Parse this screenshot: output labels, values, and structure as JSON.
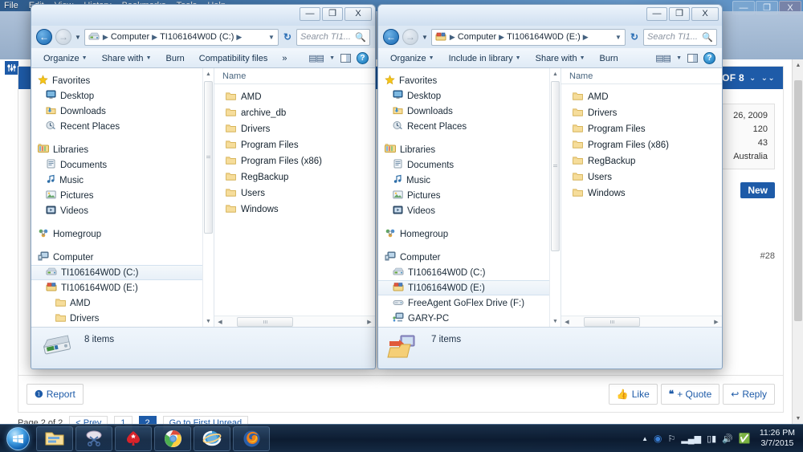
{
  "browser": {
    "menubar": [
      "File",
      "Edit",
      "View",
      "History",
      "Bookmarks",
      "Tools",
      "Help"
    ],
    "window_controls": {
      "minimize": "—",
      "maximize": "❐",
      "close": "X"
    }
  },
  "forum": {
    "post_header_text": "T OF 8",
    "infobox_rows": [
      "26, 2009",
      "120",
      "43",
      "Australia"
    ],
    "new_badge": "New",
    "post_number": "#28",
    "actions": {
      "report": "Report",
      "like": "Like",
      "quote": "+ Quote",
      "reply": "Reply"
    },
    "pager": {
      "label": "Page 2 of 2",
      "prev": "< Prev",
      "pages": [
        "1",
        "2"
      ],
      "active_page": "2",
      "goto_first_unread": "Go to First Unread"
    }
  },
  "explorer_left": {
    "title": "",
    "window_controls": {
      "minimize": "—",
      "maximize": "❐",
      "close": "X"
    },
    "address": {
      "breadcrumbs": [
        "Computer",
        "TI106164W0D (C:)"
      ],
      "drive_icon": "drive-c-icon"
    },
    "search": {
      "placeholder": "Search TI1...",
      "value": ""
    },
    "command_bar": {
      "items": [
        {
          "label": "Organize",
          "has_arrow": true
        },
        {
          "label": "Share with",
          "has_arrow": true
        },
        {
          "label": "Burn",
          "has_arrow": false
        },
        {
          "label": "Compatibility files",
          "has_arrow": false
        },
        {
          "label": "»",
          "has_arrow": false
        }
      ],
      "view_button": "change-view",
      "preview_button": "show-preview-pane",
      "help_button": "?"
    },
    "nav_pane": [
      {
        "label": "Favorites",
        "icon": "star-icon",
        "indent": 0,
        "selected": false
      },
      {
        "label": "Desktop",
        "icon": "desktop-icon",
        "indent": 1,
        "selected": false
      },
      {
        "label": "Downloads",
        "icon": "downloads-icon",
        "indent": 1,
        "selected": false
      },
      {
        "label": "Recent Places",
        "icon": "recent-places-icon",
        "indent": 1,
        "selected": false
      },
      {
        "label": "Libraries",
        "icon": "libraries-icon",
        "indent": 0,
        "selected": false,
        "gap_before": true
      },
      {
        "label": "Documents",
        "icon": "documents-icon",
        "indent": 1,
        "selected": false
      },
      {
        "label": "Music",
        "icon": "music-icon",
        "indent": 1,
        "selected": false
      },
      {
        "label": "Pictures",
        "icon": "pictures-icon",
        "indent": 1,
        "selected": false
      },
      {
        "label": "Videos",
        "icon": "videos-icon",
        "indent": 1,
        "selected": false
      },
      {
        "label": "Homegroup",
        "icon": "homegroup-icon",
        "indent": 0,
        "selected": false,
        "gap_before": true
      },
      {
        "label": "Computer",
        "icon": "computer-icon",
        "indent": 0,
        "selected": false,
        "gap_before": true
      },
      {
        "label": "TI106164W0D (C:)",
        "icon": "drive-c-icon",
        "indent": 1,
        "selected": true
      },
      {
        "label": "TI106164W0D (E:)",
        "icon": "drive-e-icon",
        "indent": 1,
        "selected": false
      },
      {
        "label": "AMD",
        "icon": "folder-icon",
        "indent": 2,
        "selected": false
      },
      {
        "label": "Drivers",
        "icon": "folder-icon",
        "indent": 2,
        "selected": false
      }
    ],
    "column_header": "Name",
    "files": [
      {
        "name": "AMD",
        "icon": "folder-icon"
      },
      {
        "name": "archive_db",
        "icon": "folder-icon"
      },
      {
        "name": "Drivers",
        "icon": "folder-icon"
      },
      {
        "name": "Program Files",
        "icon": "folder-icon"
      },
      {
        "name": "Program Files (x86)",
        "icon": "folder-icon"
      },
      {
        "name": "RegBackup",
        "icon": "folder-icon"
      },
      {
        "name": "Users",
        "icon": "folder-icon"
      },
      {
        "name": "Windows",
        "icon": "folder-icon"
      }
    ],
    "status": {
      "text": "8 items",
      "icon": "hard-drive-icon"
    }
  },
  "explorer_right": {
    "title": "",
    "window_controls": {
      "minimize": "—",
      "maximize": "❐",
      "close": "X"
    },
    "address": {
      "breadcrumbs": [
        "Computer",
        "TI106164W0D (E:)"
      ],
      "drive_icon": "drive-e-icon"
    },
    "search": {
      "placeholder": "Search TI1...",
      "value": ""
    },
    "command_bar": {
      "items": [
        {
          "label": "Organize",
          "has_arrow": true
        },
        {
          "label": "Include in library",
          "has_arrow": true
        },
        {
          "label": "Share with",
          "has_arrow": true
        },
        {
          "label": "Burn",
          "has_arrow": false
        }
      ],
      "view_button": "change-view",
      "preview_button": "show-preview-pane",
      "help_button": "?"
    },
    "nav_pane": [
      {
        "label": "Favorites",
        "icon": "star-icon",
        "indent": 0,
        "selected": false
      },
      {
        "label": "Desktop",
        "icon": "desktop-icon",
        "indent": 1,
        "selected": false
      },
      {
        "label": "Downloads",
        "icon": "downloads-icon",
        "indent": 1,
        "selected": false
      },
      {
        "label": "Recent Places",
        "icon": "recent-places-icon",
        "indent": 1,
        "selected": false
      },
      {
        "label": "Libraries",
        "icon": "libraries-icon",
        "indent": 0,
        "selected": false,
        "gap_before": true
      },
      {
        "label": "Documents",
        "icon": "documents-icon",
        "indent": 1,
        "selected": false
      },
      {
        "label": "Music",
        "icon": "music-icon",
        "indent": 1,
        "selected": false
      },
      {
        "label": "Pictures",
        "icon": "pictures-icon",
        "indent": 1,
        "selected": false
      },
      {
        "label": "Videos",
        "icon": "videos-icon",
        "indent": 1,
        "selected": false
      },
      {
        "label": "Homegroup",
        "icon": "homegroup-icon",
        "indent": 0,
        "selected": false,
        "gap_before": true
      },
      {
        "label": "Computer",
        "icon": "computer-icon",
        "indent": 0,
        "selected": false,
        "gap_before": true
      },
      {
        "label": "TI106164W0D (C:)",
        "icon": "drive-c-icon",
        "indent": 1,
        "selected": false
      },
      {
        "label": "TI106164W0D (E:)",
        "icon": "drive-e-icon",
        "indent": 1,
        "selected": true
      },
      {
        "label": "FreeAgent GoFlex Drive (F:)",
        "icon": "external-drive-icon",
        "indent": 1,
        "selected": false
      },
      {
        "label": "GARY-PC",
        "icon": "network-computer-icon",
        "indent": 1,
        "selected": false
      }
    ],
    "column_header": "Name",
    "files": [
      {
        "name": "AMD",
        "icon": "folder-icon"
      },
      {
        "name": "Drivers",
        "icon": "folder-icon"
      },
      {
        "name": "Program Files",
        "icon": "folder-icon"
      },
      {
        "name": "Program Files (x86)",
        "icon": "folder-icon"
      },
      {
        "name": "RegBackup",
        "icon": "folder-icon"
      },
      {
        "name": "Users",
        "icon": "folder-icon"
      },
      {
        "name": "Windows",
        "icon": "folder-icon"
      }
    ],
    "status": {
      "text": "7 items",
      "icon": "network-folder-icon"
    }
  },
  "taskbar": {
    "start": "start-orb",
    "buttons": [
      {
        "name": "windows-explorer-taskbar-button",
        "icon": "folder-icon"
      },
      {
        "name": "snipping-tool-taskbar-button",
        "icon": "scissors-icon"
      },
      {
        "name": "pokerstars-taskbar-button",
        "icon": "spade-icon"
      },
      {
        "name": "google-chrome-taskbar-button",
        "icon": "chrome-icon"
      },
      {
        "name": "internet-explorer-taskbar-button",
        "icon": "ie-icon"
      },
      {
        "name": "firefox-taskbar-button",
        "icon": "firefox-icon"
      }
    ],
    "tray": [
      "show-hidden-icons",
      "antivirus-icon",
      "flag-icon",
      "network-signal-icon",
      "battery-icon",
      "volume-icon",
      "shield-green-icon"
    ],
    "clock": {
      "time": "11:26 PM",
      "date": "3/7/2015"
    }
  },
  "colors": {
    "accent_blue": "#1e5ba8",
    "taskbar": "#0a182c",
    "selection": "#e8f0f8"
  }
}
